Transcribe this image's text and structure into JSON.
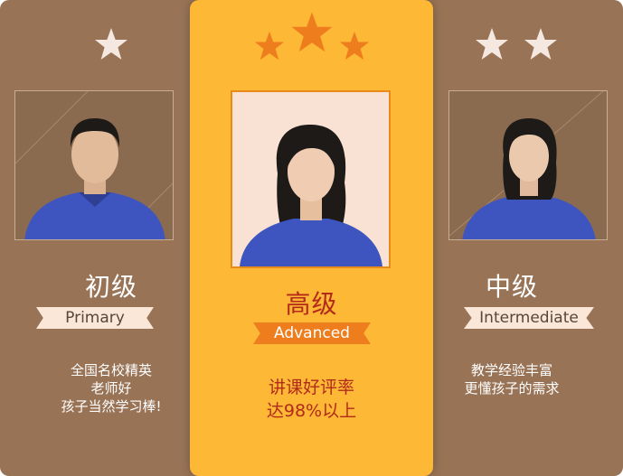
{
  "cards": [
    {
      "level": "初级",
      "tag": "Primary",
      "desc": [
        "全国名校精英",
        "老师好",
        "孩子当然学习棒!"
      ],
      "stars": 1
    },
    {
      "level": "高级",
      "tag": "Advanced",
      "desc": [
        "讲课好评率",
        "达98%以上"
      ],
      "stars": 3
    },
    {
      "level": "中级",
      "tag": "Intermediate",
      "desc": [
        "教学经验丰富",
        "更懂孩子的需求"
      ],
      "stars": 2
    }
  ],
  "colors": {
    "side_card": "#987356",
    "center_card": "#FDB836",
    "center_star": "#EE7D1E",
    "side_star": "#F5E8E0",
    "center_text": "#B3291A",
    "hoodie": "#3E55C0"
  },
  "icons": {
    "rating": "star-icon"
  }
}
